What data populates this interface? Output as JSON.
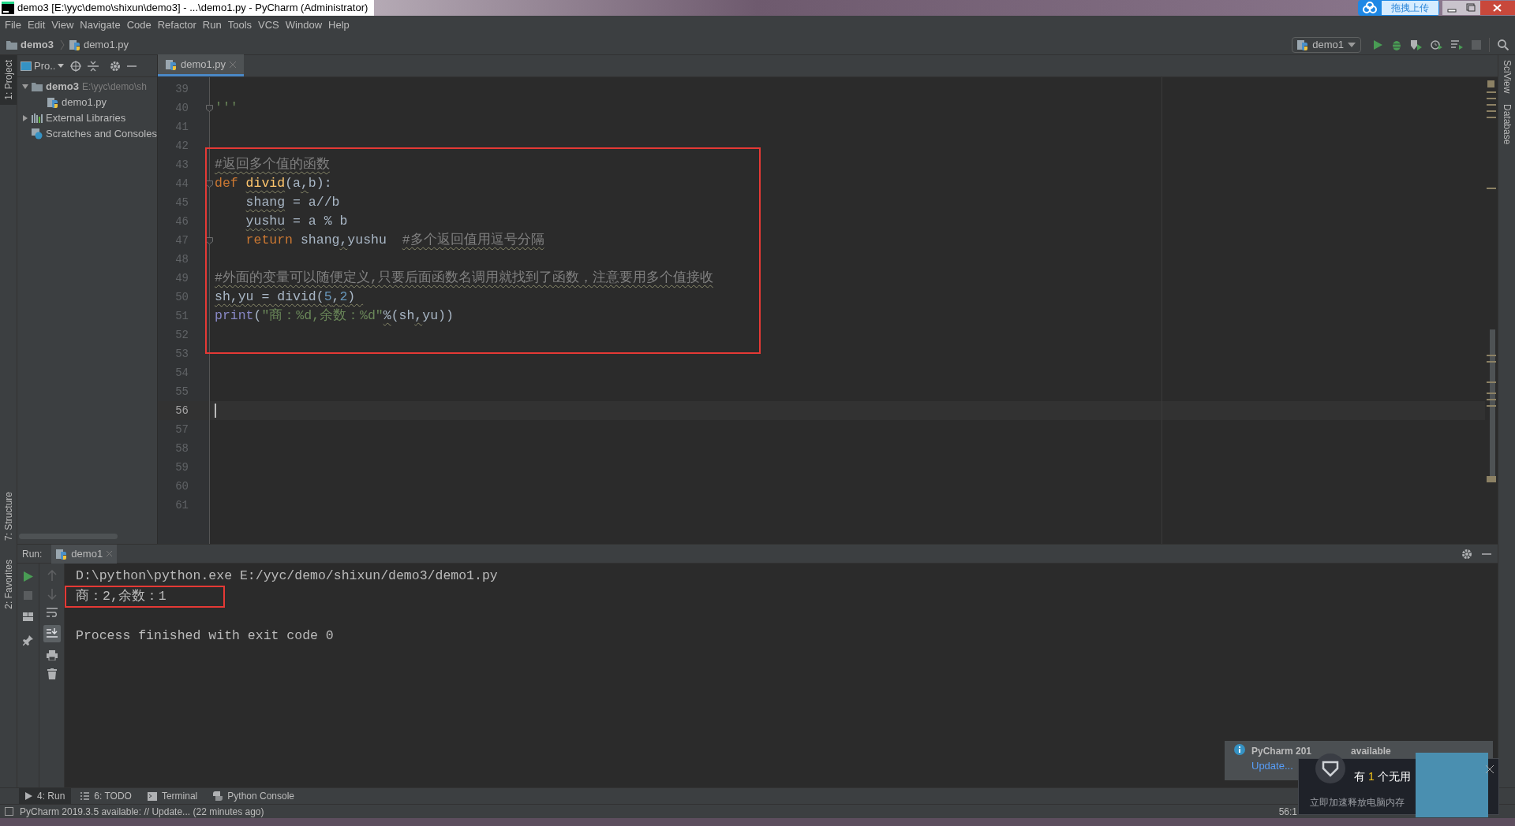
{
  "window": {
    "title": "demo3 [E:\\yyc\\demo\\shixun\\demo3] - ...\\demo1.py - PyCharm (Administrator)",
    "upload_badge": "拖拽上传"
  },
  "menu": [
    "File",
    "Edit",
    "View",
    "Navigate",
    "Code",
    "Refactor",
    "Run",
    "Tools",
    "VCS",
    "Window",
    "Help"
  ],
  "breadcrumb": [
    {
      "label": "demo3",
      "kind": "folder"
    },
    {
      "label": "demo1.py",
      "kind": "python"
    }
  ],
  "run_config": "demo1",
  "left_stripe": [
    {
      "label": "1: Project",
      "selected": true
    },
    {
      "label": "7: Structure",
      "selected": false
    },
    {
      "label": "2: Favorites",
      "selected": false
    }
  ],
  "project_panel": {
    "title": "Pro..",
    "tree": [
      {
        "label": "demo3",
        "path": "E:\\yyc\\demo\\sh",
        "kind": "folder",
        "expanded": true,
        "children": [
          {
            "label": "demo1.py",
            "kind": "python"
          }
        ]
      },
      {
        "label": "External Libraries",
        "kind": "libraries",
        "expanded": false
      },
      {
        "label": "Scratches and Consoles",
        "kind": "scratches"
      }
    ]
  },
  "editor_tabs": [
    {
      "label": "demo1.py",
      "selected": true
    }
  ],
  "editor": {
    "lines": [
      {
        "number": "39",
        "current": false
      },
      {
        "number": "40",
        "current": false,
        "fold": true,
        "tokens": [
          {
            "text": "'''",
            "kind": "string",
            "underline": false
          }
        ]
      },
      {
        "number": "41",
        "current": false
      },
      {
        "number": "42",
        "current": false
      },
      {
        "number": "43",
        "current": false,
        "tokens": [
          {
            "text": "#返回多个值的函数",
            "kind": "comment",
            "underline": true
          }
        ]
      },
      {
        "number": "44",
        "current": false,
        "fold": true,
        "tokens": [
          {
            "text": "def ",
            "kind": "keyword",
            "underline": false
          },
          {
            "text": "divid",
            "kind": "function",
            "underline": true
          },
          {
            "text": "(a",
            "kind": "plain",
            "underline": false
          },
          {
            "text": ",",
            "kind": "plain",
            "underline": true
          },
          {
            "text": "b):",
            "kind": "plain",
            "underline": false
          }
        ]
      },
      {
        "number": "45",
        "current": false,
        "tokens": [
          {
            "text": "    shang",
            "kind": "plain",
            "underline": true
          },
          {
            "text": " = a//b",
            "kind": "plain",
            "underline": false
          }
        ]
      },
      {
        "number": "46",
        "current": false,
        "tokens": [
          {
            "text": "    yushu",
            "kind": "plain",
            "underline": true
          },
          {
            "text": " = a % b",
            "kind": "plain",
            "underline": false
          }
        ]
      },
      {
        "number": "47",
        "current": false,
        "fold": true,
        "tokens": [
          {
            "text": "    return ",
            "kind": "keyword",
            "underline": false
          },
          {
            "text": "shang",
            "kind": "plain",
            "underline": false
          },
          {
            "text": ",",
            "kind": "plain",
            "underline": true
          },
          {
            "text": "yushu  ",
            "kind": "plain",
            "underline": false
          },
          {
            "text": "#多个返回值用逗号分隔",
            "kind": "comment",
            "underline": true
          }
        ]
      },
      {
        "number": "48",
        "current": false
      },
      {
        "number": "49",
        "current": false,
        "tokens": [
          {
            "text": "#外面的变量可以随便定义,只要后面函数名调用就找到了函数，注意要用多个值接收",
            "kind": "comment",
            "underline": true
          }
        ]
      },
      {
        "number": "50",
        "current": false,
        "tokens": [
          {
            "text": "sh",
            "kind": "plain",
            "underline": true
          },
          {
            "text": ",",
            "kind": "plain",
            "underline": true
          },
          {
            "text": "yu = divid(",
            "kind": "plain",
            "underline": true
          },
          {
            "text": "5",
            "kind": "number",
            "underline": true
          },
          {
            "text": ",",
            "kind": "plain",
            "underline": true
          },
          {
            "text": "2",
            "kind": "number",
            "underline": true
          },
          {
            "text": ") ",
            "kind": "plain",
            "underline": true
          }
        ]
      },
      {
        "number": "51",
        "current": false,
        "tokens": [
          {
            "text": "print",
            "kind": "builtin",
            "underline": false
          },
          {
            "text": "(",
            "kind": "plain",
            "underline": false
          },
          {
            "text": "\"商：%d,余数：%d\"",
            "kind": "string",
            "underline": false
          },
          {
            "text": "%",
            "kind": "plain",
            "underline": true
          },
          {
            "text": "(sh",
            "kind": "plain",
            "underline": false
          },
          {
            "text": ",",
            "kind": "plain",
            "underline": true
          },
          {
            "text": "yu))",
            "kind": "plain",
            "underline": false
          }
        ]
      },
      {
        "number": "52",
        "current": false
      },
      {
        "number": "53",
        "current": false
      },
      {
        "number": "54",
        "current": false
      },
      {
        "number": "55",
        "current": false
      },
      {
        "number": "56",
        "current": true
      },
      {
        "number": "57",
        "current": false
      },
      {
        "number": "58",
        "current": false
      },
      {
        "number": "59",
        "current": false
      },
      {
        "number": "60",
        "current": false
      },
      {
        "number": "61",
        "current": false
      }
    ]
  },
  "right_stripe": [
    "SciView",
    "Database"
  ],
  "run_panel": {
    "label": "Run:",
    "tabs": [
      {
        "label": "demo1",
        "selected": true
      }
    ],
    "output": [
      {
        "text": "D:\\python\\python.exe E:/yyc/demo/shixun/demo3/demo1.py",
        "kind": "command",
        "boxed": false
      },
      {
        "text": "商：2,余数：1",
        "kind": "stdout",
        "boxed": true
      },
      {
        "text": "Process finished with exit code 0",
        "kind": "exit",
        "boxed": false
      }
    ]
  },
  "bottom_tabs": [
    {
      "label": "4: Run",
      "kind": "run",
      "selected": true
    },
    {
      "label": "6: TODO",
      "kind": "todo",
      "selected": false
    },
    {
      "label": "Terminal",
      "kind": "terminal",
      "selected": false
    },
    {
      "label": "Python Console",
      "kind": "console",
      "selected": false
    }
  ],
  "status_bar": {
    "message": "PyCharm 2019.3.5 available: // Update... (22 minutes ago)",
    "position": "56:1"
  },
  "notification": {
    "title_start": "PyCharm 201",
    "title_end": "available",
    "link": "Update..."
  },
  "cleaner_popup": {
    "prefix": "有",
    "count": "1",
    "suffix": "个无用",
    "subtitle": "立即加速释放电脑内存"
  }
}
